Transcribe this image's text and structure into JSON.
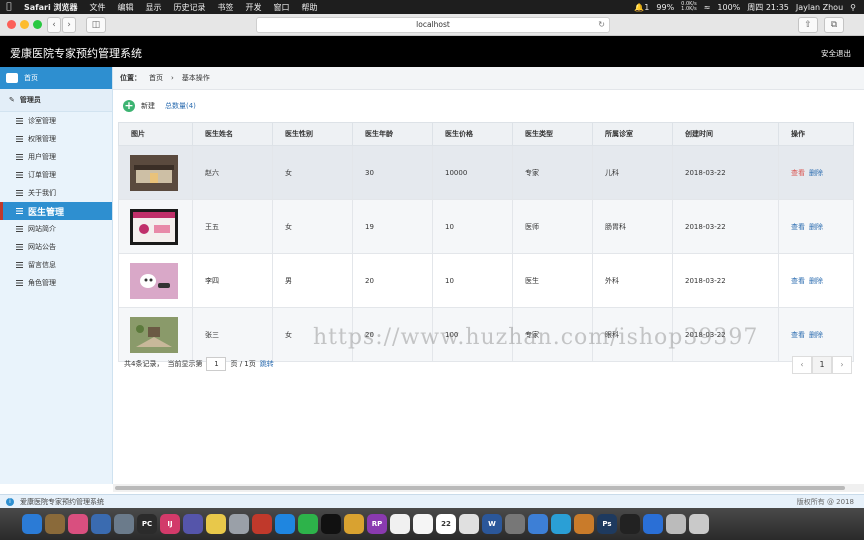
{
  "menubar": {
    "apple": "",
    "items": [
      "Safari 浏览器",
      "文件",
      "编辑",
      "显示",
      "历史记录",
      "书签",
      "开发",
      "窗口",
      "帮助"
    ],
    "notif_count": "1",
    "battery_small": "99%",
    "net_up": "0.0K/s",
    "net_down": "1.0K/s",
    "battery": "100%",
    "clock": "周四 21:35",
    "user": "Jaylan Zhou"
  },
  "browser": {
    "back": "‹",
    "forward": "›",
    "url": "localhost",
    "reload": "↻"
  },
  "app": {
    "title": "爱康医院专家预约管理系统",
    "logout": "安全退出"
  },
  "sidebar": {
    "home": "首页",
    "group": "管理员",
    "items": [
      {
        "label": "诊室管理"
      },
      {
        "label": "权限管理"
      },
      {
        "label": "用户管理"
      },
      {
        "label": "订单管理"
      },
      {
        "label": "关于我们"
      },
      {
        "label": "医生管理",
        "active": true
      },
      {
        "label": "网站简介"
      },
      {
        "label": "网站公告"
      },
      {
        "label": "留言信息"
      },
      {
        "label": "角色管理"
      }
    ]
  },
  "breadcrumb": {
    "label": "位置：",
    "home": "首页",
    "sep": "›",
    "current": "基本操作"
  },
  "toolbar": {
    "new": "新建",
    "total": "总数量(4)"
  },
  "table": {
    "headers": [
      "图片",
      "医生姓名",
      "医生性别",
      "医生年龄",
      "医生价格",
      "医生类型",
      "所属诊室",
      "创建时间",
      "操作"
    ],
    "rows": [
      {
        "name": "赵六",
        "gender": "女",
        "age": "30",
        "price": "10000",
        "type": "专家",
        "dept": "儿科",
        "created": "2018-03-22",
        "view": "查看",
        "del": "删除",
        "thumb": "#5a4a3e"
      },
      {
        "name": "王五",
        "gender": "女",
        "age": "19",
        "price": "10",
        "type": "医师",
        "dept": "肠胃科",
        "created": "2018-03-22",
        "view": "查看",
        "del": "删除",
        "thumb": "#c0306a"
      },
      {
        "name": "李四",
        "gender": "男",
        "age": "20",
        "price": "10",
        "type": "医生",
        "dept": "外科",
        "created": "2018-03-22",
        "view": "查看",
        "del": "删除",
        "thumb": "#d9a8c8"
      },
      {
        "name": "张三",
        "gender": "女",
        "age": "20",
        "price": "100",
        "type": "专家",
        "dept": "眼科",
        "created": "2018-03-22",
        "view": "查看",
        "del": "删除",
        "thumb": "#8a9a6a"
      }
    ]
  },
  "pager": {
    "summary": "共4条记录，",
    "current_prefix": "当前显示第",
    "page_value": "1",
    "page_suffix": "页 / 1页",
    "jump": "跳转",
    "prev": "‹",
    "current": "1",
    "next": "›"
  },
  "watermark": "https://www.huzhan.com/ishop39397",
  "status": {
    "info_icon": "i",
    "text": "爱康医院专家预约管理系统",
    "copyright": "版权所有 @ 2018"
  },
  "dock": {
    "labels": [
      "",
      "",
      "",
      "",
      "",
      "PC",
      "IJ",
      "",
      "",
      "",
      "",
      "",
      "",
      "",
      "",
      "RP",
      "",
      "",
      "22",
      "",
      "W",
      "",
      "",
      "",
      "",
      "Ps",
      "",
      "",
      "",
      ""
    ],
    "colors": [
      "#2b7bd6",
      "#8a6a3a",
      "#d94f7f",
      "#3a6bb0",
      "#6b7b8b",
      "#2b2b2b",
      "#d23a6a",
      "#5555aa",
      "#e8c84a",
      "#9aa0a8",
      "#c0392b",
      "#1f86e0",
      "#2db34a",
      "#111111",
      "#d9a230",
      "#8a3ab0",
      "#f0f0f0",
      "#f5f5f5",
      "#ffffff",
      "#e0e0e0",
      "#2b579a",
      "#777777",
      "#3d7fd6",
      "#2a9fd6",
      "#c97b2a",
      "#1e3a5f",
      "#222222",
      "#2a6fd6",
      "#bbbbbb",
      "#c9c9c9"
    ]
  }
}
